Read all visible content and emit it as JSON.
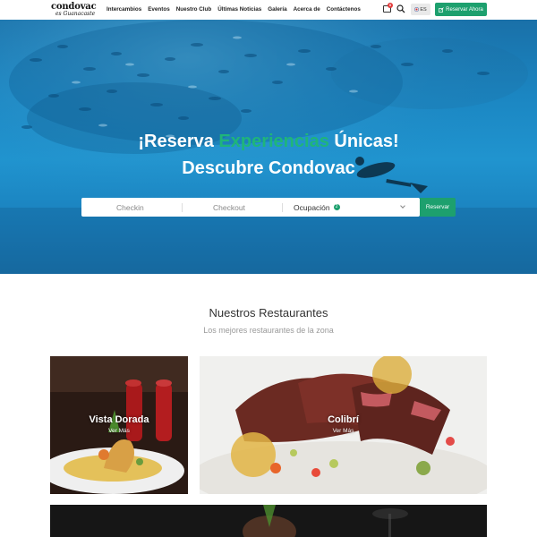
{
  "brand": {
    "logo_main": "condovac",
    "logo_sub": "es Guanacaste"
  },
  "nav": {
    "links": [
      "Intercambios",
      "Eventos",
      "Nuestro Club",
      "Últimas Noticias",
      "Galería",
      "Acerca de",
      "Contáctenos"
    ],
    "chat_count": "0",
    "language": "ES",
    "reserve_button": "Reservar Ahora"
  },
  "hero": {
    "title_part1": "¡Reserva ",
    "title_accent": "Experiencias",
    "title_part2": " Únicas!",
    "title_line2": "Descubre Condovac",
    "accent_color": "#1fb57a"
  },
  "booking": {
    "checkin_placeholder": "Checkin",
    "checkout_placeholder": "Checkout",
    "occupancy_label": "Ocupación",
    "occupancy_count": "2",
    "reserve_label": "Reservar"
  },
  "restaurants": {
    "title": "Nuestros Restaurantes",
    "subtitle": "Los mejores restaurantes de la zona",
    "cards": [
      {
        "name": "Vista Dorada",
        "link": "Ver Más"
      },
      {
        "name": "Colibrí",
        "link": "Ver Más"
      }
    ]
  },
  "colors": {
    "brand_green": "#1da06e",
    "ocean_blue": "#1b86c2"
  }
}
